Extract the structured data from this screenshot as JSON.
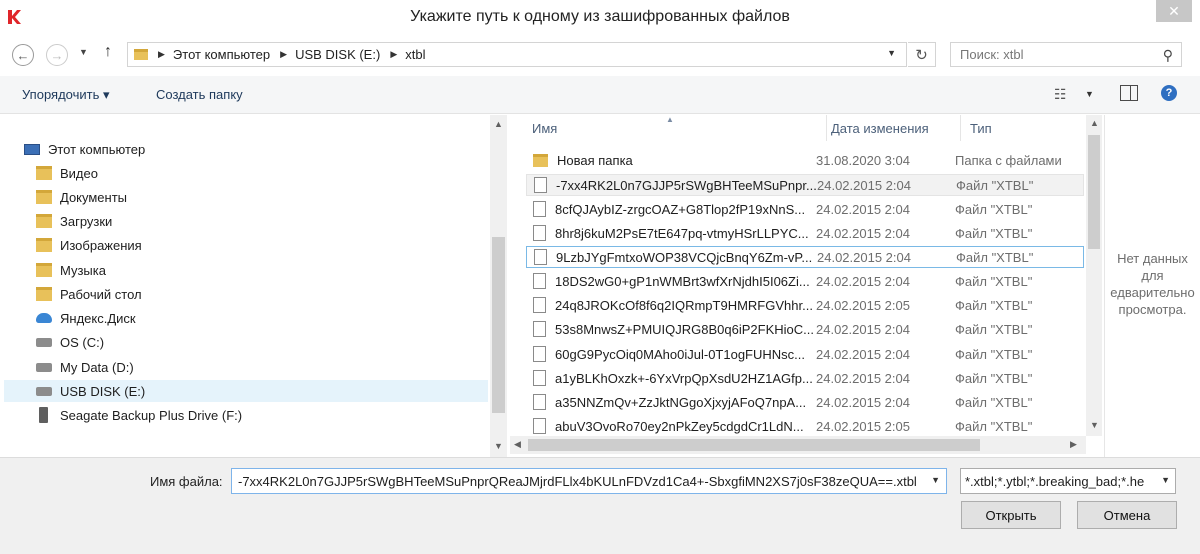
{
  "window": {
    "title": "Укажите путь к одному из зашифрованных файлов",
    "close_label": "✕"
  },
  "navigation": {
    "breadcrumbs": [
      "Этот компьютер",
      "USB DISK (E:)",
      "xtbl"
    ],
    "search_placeholder": "Поиск: xtbl"
  },
  "toolbar": {
    "organize_label": "Упорядочить ▾",
    "new_folder_label": "Создать папку",
    "help_label": "?"
  },
  "sidebar": {
    "items": [
      {
        "label": "Этот компьютер",
        "icon": "computer-icon"
      },
      {
        "label": "Видео",
        "icon": "video-folder-icon"
      },
      {
        "label": "Документы",
        "icon": "documents-folder-icon"
      },
      {
        "label": "Загрузки",
        "icon": "downloads-folder-icon"
      },
      {
        "label": "Изображения",
        "icon": "pictures-folder-icon"
      },
      {
        "label": "Музыка",
        "icon": "music-folder-icon"
      },
      {
        "label": "Рабочий стол",
        "icon": "desktop-folder-icon"
      },
      {
        "label": "Яндекс.Диск",
        "icon": "cloud-icon"
      },
      {
        "label": "OS (C:)",
        "icon": "drive-icon"
      },
      {
        "label": "My Data (D:)",
        "icon": "drive-icon"
      },
      {
        "label": "USB DISK (E:)",
        "icon": "usb-drive-icon",
        "selected": true
      },
      {
        "label": "Seagate Backup Plus Drive (F:)",
        "icon": "usb-stick-icon"
      }
    ]
  },
  "file_list": {
    "columns": [
      "Имя",
      "Дата изменения",
      "Тип"
    ],
    "rows": [
      {
        "name": "Новая папка",
        "date": "31.08.2020 3:04",
        "type": "Папка с файлами",
        "kind": "folder"
      },
      {
        "name": "-7xx4RK2L0n7GJJP5rSWgBHTeeMSuPnpr...",
        "date": "24.02.2015 2:04",
        "type": "Файл \"XTBL\"",
        "kind": "file"
      },
      {
        "name": "8cfQJAybIZ-zrgcOAZ+G8Tlop2fP19xNnS...",
        "date": "24.02.2015 2:04",
        "type": "Файл \"XTBL\"",
        "kind": "file"
      },
      {
        "name": "8hr8j6kuM2PsE7tE647pq-vtmyHSrLLPYC...",
        "date": "24.02.2015 2:04",
        "type": "Файл \"XTBL\"",
        "kind": "file"
      },
      {
        "name": "9LzbJYgFmtxoWOP38VCQjcBnqY6Zm-vP...",
        "date": "24.02.2015 2:04",
        "type": "Файл \"XTBL\"",
        "kind": "file"
      },
      {
        "name": "18DS2wG0+gP1nWMBrt3wfXrNjdhI5I06Zi...",
        "date": "24.02.2015 2:04",
        "type": "Файл \"XTBL\"",
        "kind": "file"
      },
      {
        "name": "24q8JROKcOf8f6q2IQRmpT9HMRFGVhhr...",
        "date": "24.02.2015 2:05",
        "type": "Файл \"XTBL\"",
        "kind": "file"
      },
      {
        "name": "53s8MnwsZ+PMUIQJRG8B0q6iP2FKHioC...",
        "date": "24.02.2015 2:04",
        "type": "Файл \"XTBL\"",
        "kind": "file"
      },
      {
        "name": "60gG9PycOiq0MAho0iJul-0T1ogFUHNsc...",
        "date": "24.02.2015 2:04",
        "type": "Файл \"XTBL\"",
        "kind": "file"
      },
      {
        "name": "a1yBLKhOxzk+-6YxVrpQpXsdU2HZ1AGfp...",
        "date": "24.02.2015 2:04",
        "type": "Файл \"XTBL\"",
        "kind": "file"
      },
      {
        "name": "a35NNZmQv+ZzJktNGgoXjxyjAFoQ7npA...",
        "date": "24.02.2015 2:04",
        "type": "Файл \"XTBL\"",
        "kind": "file"
      },
      {
        "name": "abuV3OvoRo70ey2nPkZey5cdgdCr1LdN...",
        "date": "24.02.2015 2:05",
        "type": "Файл \"XTBL\"",
        "kind": "file"
      }
    ]
  },
  "preview": {
    "lines": [
      "Нет данных",
      "для",
      "едварительно",
      "просмотра."
    ]
  },
  "footer": {
    "filename_label": "Имя файла:",
    "filename_value": "-7xx4RK2L0n7GJJP5rSWgBHTeeMSuPnprQReaJMjrdFLlx4bKULnFDVzd1Ca4+-SbxgfiMN2XS7j0sF38zeQUA==.xtbl",
    "filter_value": "*.xtbl;*.ytbl;*.breaking_bad;*.he",
    "open_label": "Открыть",
    "cancel_label": "Отмена"
  },
  "colors": {
    "accent": "#2f6fc1",
    "selection": "#e5f3fb",
    "focus_border": "#7ab9e6",
    "logo": "#e0252a"
  }
}
